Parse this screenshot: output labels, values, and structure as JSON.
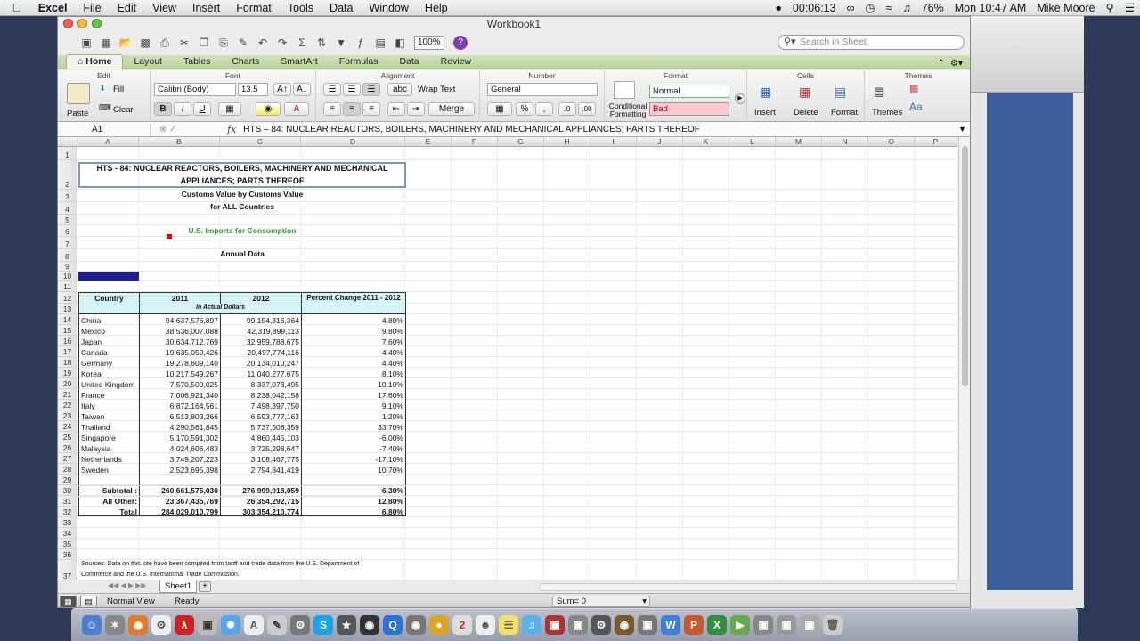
{
  "menubar": {
    "apple": "",
    "app_name": "Excel",
    "items": [
      "File",
      "Edit",
      "View",
      "Insert",
      "Format",
      "Tools",
      "Data",
      "Window",
      "Help"
    ],
    "recording_time": "00:06:13",
    "battery": "76%",
    "clock": "Mon 10:47 AM",
    "user": "Mike Moore"
  },
  "window": {
    "title": "Workbook1"
  },
  "toolbar": {
    "zoom": "100%",
    "search_placeholder": "Search in Sheet"
  },
  "ribbon": {
    "tabs": [
      "Home",
      "Layout",
      "Tables",
      "Charts",
      "SmartArt",
      "Formulas",
      "Data",
      "Review"
    ],
    "groups": {
      "edit": "Edit",
      "font": "Font",
      "alignment": "Alignment",
      "number": "Number",
      "format": "Format",
      "cells": "Cells",
      "themes": "Themes"
    },
    "paste": "Paste",
    "fill": "Fill",
    "clear": "Clear",
    "font_name": "Calibri (Body)",
    "font_size": "13.5",
    "bold": "B",
    "italic": "I",
    "underline": "U",
    "wrap_text": "Wrap Text",
    "merge": "Merge",
    "abc": "abc",
    "number_format": "General",
    "percent": "%",
    "conditional_formatting": "Conditional Formatting",
    "style_normal": "Normal",
    "style_bad": "Bad",
    "insert": "Insert",
    "delete": "Delete",
    "format": "Format",
    "themes": "Themes"
  },
  "formula_bar": {
    "cell_ref": "A1",
    "fx": "fx",
    "content": "HTS – 84: NUCLEAR REACTORS, BOILERS, MACHINERY AND MECHANICAL APPLIANCES; PARTS THEREOF"
  },
  "columns": [
    "A",
    "B",
    "C",
    "D",
    "E",
    "F",
    "G",
    "H",
    "I",
    "J",
    "K",
    "L",
    "M",
    "N",
    "O",
    "P"
  ],
  "sheet": {
    "title_line1": "HTS - 84: NUCLEAR REACTORS, BOILERS, MACHINERY AND MECHANICAL",
    "title_line2": "APPLIANCES; PARTS THEREOF",
    "subtitle1": "Customs Value by Customs Value",
    "subtitle2": "for ALL Countries",
    "imports": "U.S. Imports for Consumption",
    "annual": "Annual Data",
    "headers": {
      "country": "Country",
      "y2011": "2011",
      "y2012": "2012",
      "pct": "Percent Change 2011 - 2012"
    },
    "units": "In Actual Dollars",
    "rows": [
      [
        "China",
        "94,637,576,897",
        "99,154,316,364",
        "4.80%"
      ],
      [
        "Mexico",
        "38,536,007,088",
        "42,319,899,113",
        "9.80%"
      ],
      [
        "Japan",
        "30,634,712,769",
        "32,959,788,675",
        "7.60%"
      ],
      [
        "Canada",
        "19,635,059,426",
        "20,497,774,116",
        "4.40%"
      ],
      [
        "Germany",
        "19,278,609,140",
        "20,134,010,247",
        "4.40%"
      ],
      [
        "Korea",
        "10,217,549,267",
        "11,040,277,675",
        "8.10%"
      ],
      [
        "United Kingdom",
        "7,570,509,025",
        "8,337,073,495",
        "10.10%"
      ],
      [
        "France",
        "7,006,921,340",
        "8,238,042,158",
        "17.60%"
      ],
      [
        "Italy",
        "6,872,164,561",
        "7,498,397,750",
        "9.10%"
      ],
      [
        "Taiwan",
        "6,513,803,266",
        "6,593,777,163",
        "1.20%"
      ],
      [
        "Thailand",
        "4,290,561,845",
        "5,737,508,359",
        "33.70%"
      ],
      [
        "Singapore",
        "5,170,591,302",
        "4,860,445,103",
        "-6.00%"
      ],
      [
        "Malaysia",
        "4,024,606,483",
        "3,725,298,647",
        "-7.40%"
      ],
      [
        "Netherlands",
        "3,749,207,223",
        "3,108,467,775",
        "-17.10%"
      ],
      [
        "Sweden",
        "2,523,695,398",
        "2,794,841,419",
        "10.70%"
      ]
    ],
    "subtotal": [
      "Subtotal :",
      "260,661,575,030",
      "276,999,918,059",
      "6.30%"
    ],
    "all_other": [
      "All Other:",
      "23,367,435,769",
      "26,354,292,715",
      "12.80%"
    ],
    "total": [
      "Total",
      "284,029,010,799",
      "303,354,210,774",
      "6.80%"
    ],
    "sources_line1": "Sources: Data on this site have been compiled from tariff and trade data from the U.S. Department of",
    "sources_line2": "Commerce and the U.S. International Trade Commission."
  },
  "tabs": {
    "sheet1": "Sheet1",
    "add": "+"
  },
  "status": {
    "view": "Normal View",
    "ready": "Ready",
    "sum": "Sum= 0"
  }
}
